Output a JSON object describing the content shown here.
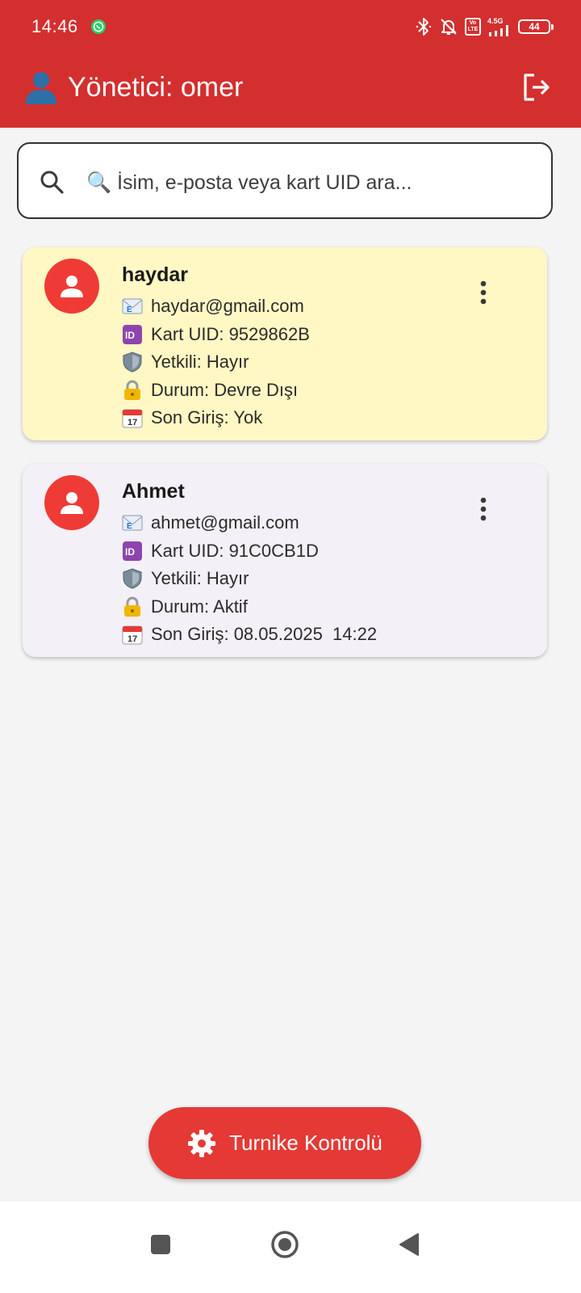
{
  "status_bar": {
    "time": "14:46",
    "network_label": "4.5G",
    "volte_label": "Vo LTE",
    "battery": "44"
  },
  "app_bar": {
    "title": "Yönetici: omer",
    "icons": [
      "person-icon",
      "logout-icon"
    ]
  },
  "search": {
    "placeholder": "🔍 İsim, e-posta veya kart UID ara...",
    "value": ""
  },
  "users": [
    {
      "name": "haydar",
      "email": "haydar@gmail.com",
      "uid": "Kart UID: 9529862B",
      "authorized": "Yetkili: Hayır",
      "status": "Durum: Devre Dışı",
      "last_login": "Son Giriş: Yok",
      "background": "#fff8c4"
    },
    {
      "name": "Ahmet",
      "email": "ahmet@gmail.com",
      "uid": "Kart UID: 91C0CB1D",
      "authorized": "Yetkili: Hayır",
      "status": "Durum: Aktif",
      "last_login": "Son Giriş: 08.05.2025  14:22",
      "background": "#f3f0f7"
    }
  ],
  "actions": {
    "turnike_label": "Turnike Kontrolü"
  },
  "colors": {
    "primary": "#d32f2f",
    "button": "#e53935",
    "avatar": "#ef3b35"
  }
}
